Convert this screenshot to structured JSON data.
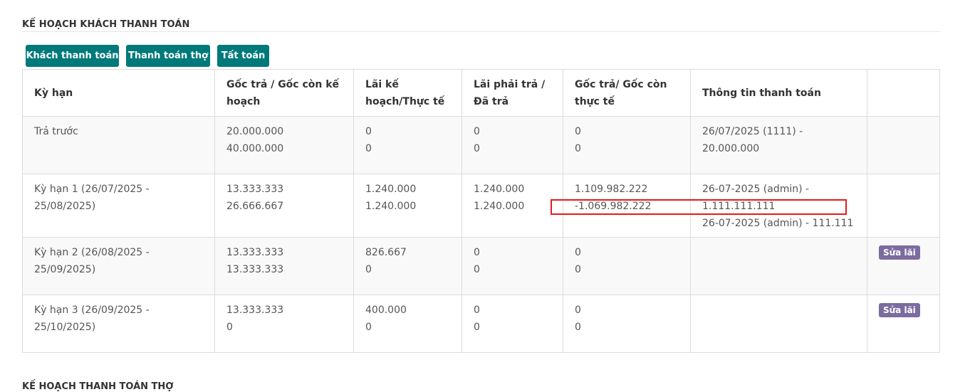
{
  "section": {
    "title": "KẾ HOẠCH KHÁCH THANH TOÁN"
  },
  "buttons": {
    "customer_payment": "Khách thanh toán",
    "worker_payment": "Thanh toán thợ",
    "settle": "Tất toán"
  },
  "table": {
    "headers": [
      "Kỳ hạn",
      "Gốc trả / Gốc còn kế hoạch",
      "Lãi kế hoạch/Thực tế",
      "Lãi phải trả / Đã trả",
      "Gốc trả/ Gốc còn thực tế",
      "Thông tin thanh toán",
      ""
    ],
    "rows": [
      {
        "period": "Trả trước",
        "principal_plan": [
          "20.000.000",
          "40.000.000"
        ],
        "interest_plan": [
          "0",
          "0"
        ],
        "interest_due": [
          "0",
          "0"
        ],
        "principal_actual": [
          "0",
          "0"
        ],
        "payment_info": [
          "26/07/2025 (1111) - 20.000.000"
        ],
        "action": ""
      },
      {
        "period": "Kỳ hạn 1 (26/07/2025 - 25/08/2025)",
        "principal_plan": [
          "13.333.333",
          "26.666.667"
        ],
        "interest_plan": [
          "1.240.000",
          "1.240.000"
        ],
        "interest_due": [
          "1.240.000",
          "1.240.000"
        ],
        "principal_actual": [
          "1.109.982.222",
          "-1.069.982.222"
        ],
        "payment_info": [
          "26-07-2025 (admin) - 1.111.111.111",
          "26-07-2025 (admin) - 111.111"
        ],
        "action": ""
      },
      {
        "period": "Kỳ hạn 2 (26/08/2025 - 25/09/2025)",
        "principal_plan": [
          "13.333.333",
          "13.333.333"
        ],
        "interest_plan": [
          "826.667",
          "0"
        ],
        "interest_due": [
          "0",
          "0"
        ],
        "principal_actual": [
          "0",
          "0"
        ],
        "payment_info": [],
        "action": "Sửa lãi"
      },
      {
        "period": "Kỳ hạn 3 (26/09/2025 - 25/10/2025)",
        "principal_plan": [
          "13.333.333",
          "0"
        ],
        "interest_plan": [
          "400.000",
          "0"
        ],
        "interest_due": [
          "0",
          "0"
        ],
        "principal_actual": [
          "0",
          "0"
        ],
        "payment_info": [],
        "action": "Sửa lãi"
      }
    ]
  },
  "next_section": {
    "title": "KẾ HOẠCH THANH TOÁN THỢ"
  },
  "colors": {
    "button_bg": "#00797b",
    "badge_bg": "#7c6ba0",
    "highlight": "#e41b1b"
  }
}
